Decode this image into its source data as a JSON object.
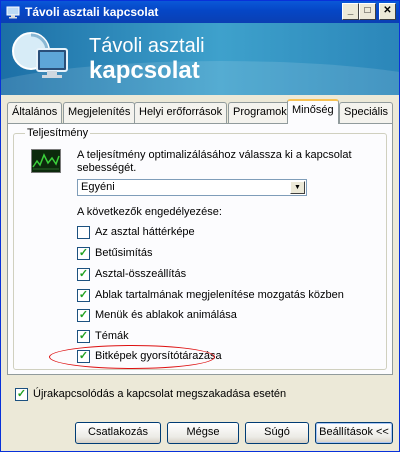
{
  "window": {
    "title": "Távoli asztali kapcsolat"
  },
  "banner": {
    "line1": "Távoli asztali",
    "line2": "kapcsolat"
  },
  "tabs": [
    {
      "label": "Általános"
    },
    {
      "label": "Megjelenítés"
    },
    {
      "label": "Helyi erőforrások"
    },
    {
      "label": "Programok"
    },
    {
      "label": "Minőség"
    },
    {
      "label": "Speciális"
    }
  ],
  "active_tab": "Minőség",
  "performance": {
    "group_label": "Teljesítmény",
    "description": "A teljesítmény optimalizálásához válassza ki a kapcsolat sebességét.",
    "speed_select": {
      "value": "Egyéni"
    },
    "enable_label": "A következők engedélyezése:",
    "options": [
      {
        "label": "Az asztal háttérképe",
        "checked": false
      },
      {
        "label": "Betűsimítás",
        "checked": true
      },
      {
        "label": "Asztal-összeállítás",
        "checked": true
      },
      {
        "label": "Ablak tartalmának megjelenítése mozgatás közben",
        "checked": true
      },
      {
        "label": "Menük és ablakok animálása",
        "checked": true
      },
      {
        "label": "Témák",
        "checked": true
      },
      {
        "label": "Bitképek gyorsítótárazása",
        "checked": true
      }
    ]
  },
  "reconnect": {
    "label": "Újrakapcsolódás a kapcsolat megszakadása esetén",
    "checked": true
  },
  "buttons": {
    "connect": "Csatlakozás",
    "cancel": "Mégse",
    "help": "Súgó",
    "options": "Beállítások <<"
  },
  "colors": {
    "titlebar": "#0a58d8",
    "banner": "#2b86b9",
    "annotation_ellipse": "#dd1111",
    "check_mark": "#21a121"
  }
}
